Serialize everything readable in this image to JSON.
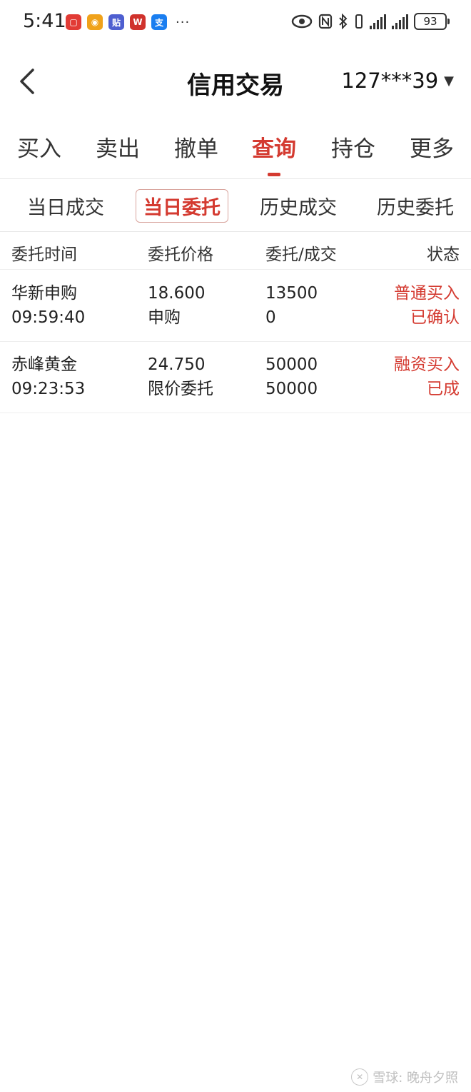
{
  "status_bar": {
    "time": "5:41",
    "app_icons": [
      {
        "name": "huawei-appgallery-icon",
        "glyph": "▢",
        "color": "#e23b35"
      },
      {
        "name": "weibo-icon",
        "glyph": "◉",
        "color": "#f0a21a"
      },
      {
        "name": "tieba-icon",
        "glyph": "贴",
        "color": "#4e5fd0"
      },
      {
        "name": "wps-icon",
        "glyph": "W",
        "color": "#d0322c"
      },
      {
        "name": "alipay-icon",
        "glyph": "支",
        "color": "#1a7ef0"
      }
    ],
    "more": "···",
    "battery": "93"
  },
  "header": {
    "title": "信用交易",
    "account": "127***39"
  },
  "main_tabs": [
    {
      "label": "买入"
    },
    {
      "label": "卖出"
    },
    {
      "label": "撤单"
    },
    {
      "label": "查询"
    },
    {
      "label": "持仓"
    },
    {
      "label": "更多"
    }
  ],
  "sub_tabs": [
    {
      "label": "当日成交"
    },
    {
      "label": "当日委托"
    },
    {
      "label": "历史成交"
    },
    {
      "label": "历史委托"
    }
  ],
  "table": {
    "columns": [
      "委托时间",
      "委托价格",
      "委托/成交",
      "状态"
    ],
    "rows": [
      {
        "name": "华新申购",
        "time": "09:59:40",
        "price": "18.600",
        "price_type": "申购",
        "order_qty": "13500",
        "filled_qty": "0",
        "side": "普通买入",
        "status": "已确认"
      },
      {
        "name": "赤峰黄金",
        "time": "09:23:53",
        "price": "24.750",
        "price_type": "限价委托",
        "order_qty": "50000",
        "filled_qty": "50000",
        "side": "融资买入",
        "status": "已成"
      }
    ]
  },
  "watermark": "雪球: 晚舟夕照",
  "colors": {
    "accent": "#d43a30"
  }
}
